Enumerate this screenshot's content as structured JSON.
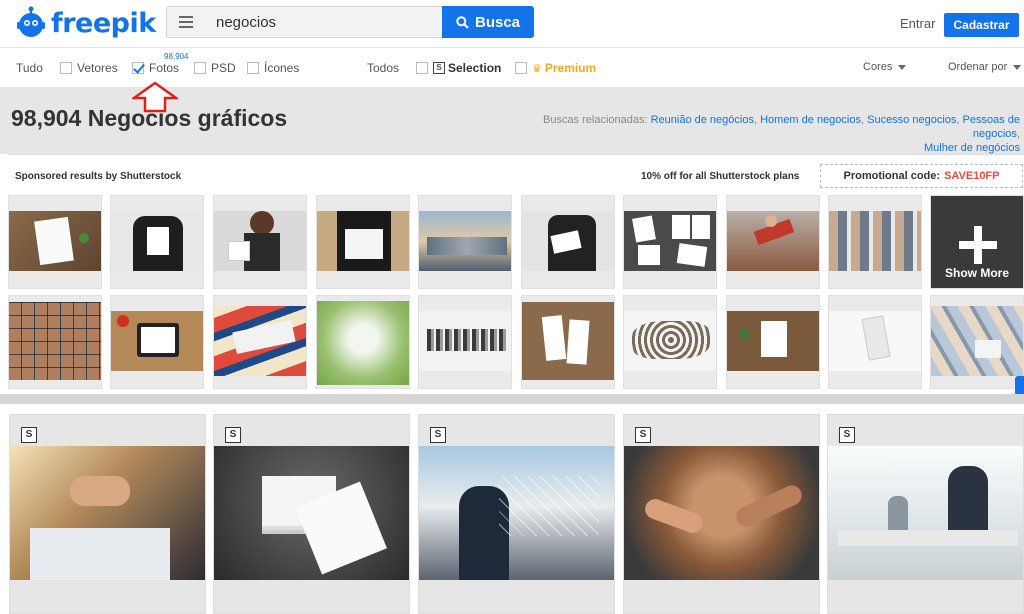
{
  "header": {
    "logo_text": "freepik",
    "search_value": "negocios",
    "search_button": "Busca",
    "login": "Entrar",
    "signup": "Cadastrar"
  },
  "filters": {
    "all_types": "Tudo",
    "vectors": "Vetores",
    "photos": "Fotos",
    "photos_count": "98,904",
    "psd": "PSD",
    "icons": "Ícones",
    "all_licenses": "Todos",
    "selection": "Selection",
    "premium": "Premium",
    "colors": "Cores",
    "sort": "Ordenar por"
  },
  "title": {
    "heading": "98,904 Negocios gráficos",
    "related_label": "Buscas relacionadas:",
    "related": [
      "Reunião de negócios",
      "Homem de negocios",
      "Sucesso negocios",
      "Pessoas de negocios",
      "Mulher de negócios"
    ]
  },
  "sponsored": {
    "label": "Sponsored results by Shutterstock",
    "offer": "10% off for all Shutterstock plans",
    "promo_label": "Promotional code:",
    "promo_code": "SAVE10FP",
    "show_more": "Show More"
  },
  "colors": {
    "brand": "#1273eb",
    "promo": "#e74c3c",
    "premium": "#f5a623"
  }
}
